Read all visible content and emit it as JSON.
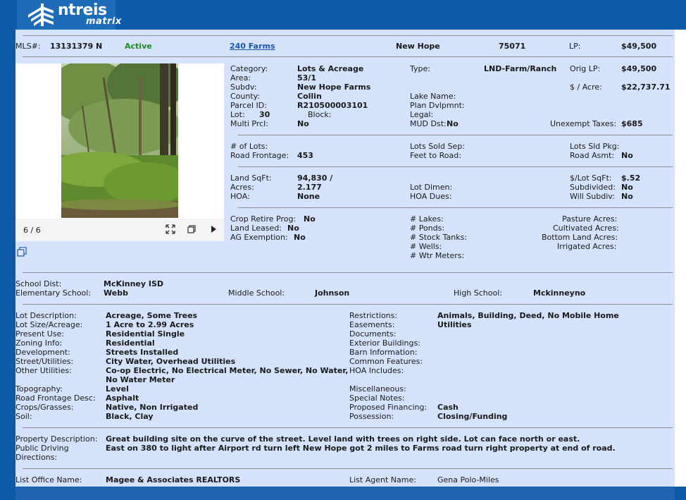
{
  "app": {
    "brand_main": "ntreis",
    "brand_sub": "matrix"
  },
  "summary": {
    "mls_label": "MLS#:",
    "mls_number": "13131379 N",
    "status": "Active",
    "address": "240 Farms",
    "city": "New Hope",
    "zip": "75071",
    "lp_label": "LP:",
    "lp_value": "$49,500"
  },
  "photo": {
    "counter": "6 / 6"
  },
  "fields": {
    "category_label": "Category:",
    "category_value": "Lots & Acreage",
    "area_label": "Area:",
    "area_value": "53/1",
    "subdv_label": "Subdv:",
    "subdv_value": "New Hope Farms",
    "county_label": "County:",
    "county_value": "Collin",
    "parcel_label": "Parcel ID:",
    "parcel_value": "R210500003101",
    "lot_label": "Lot:",
    "lot_value": "30",
    "block_label": "Block:",
    "multi_label": "Multi Prcl:",
    "multi_value": "No",
    "type_label": "Type:",
    "type_value": "LND-Farm/Ranch",
    "lake_label": "Lake Name:",
    "plan_label": "Plan Dvlpmnt:",
    "legal_label": "Legal:",
    "mud_label": "MUD Dst:",
    "mud_value": "No",
    "origlp_label": "Orig LP:",
    "origlp_value": "$49,500",
    "peracre_label": "$ / Acre:",
    "peracre_value": "$22,737.71",
    "taxes_label": "Unexempt Taxes:",
    "taxes_value": "$685",
    "numlots_label": "# of Lots:",
    "frontage_label": "Road Frontage:",
    "frontage_value": "453",
    "soldsep_label": "Lots Sold Sep:",
    "feet_label": "Feet to Road:",
    "sldpkg_label": "Lots Sld Pkg:",
    "roadasmt_label": "Road Asmt:",
    "roadasmt_value": "No",
    "sqft_label": "Land SqFt:",
    "sqft_value": "94,830 /",
    "acres_label": "Acres:",
    "acres_value": "2.177",
    "hoa_label": "HOA:",
    "hoa_value": "None",
    "lotdimen_label": "Lot Dimen:",
    "hoadues_label": "HOA Dues:",
    "lotsqft_label": "$/Lot SqFt:",
    "lotsqft_value": "$.52",
    "subdivided_label": "Subdivided:",
    "subdivided_value": "No",
    "willsub_label": "Will Subdiv:",
    "willsub_value": "No",
    "crop_label": "Crop Retire Prog:",
    "crop_value": "No",
    "leased_label": "Land Leased:",
    "leased_value": "No",
    "ag_label": "AG Exemption:",
    "ag_value": "No",
    "lakes_label": "# Lakes:",
    "ponds_label": "# Ponds:",
    "tanks_label": "# Stock Tanks:",
    "wells_label": "# Wells:",
    "meters_label": "# Wtr Meters:",
    "pasture_label": "Pasture Acres:",
    "cultivated_label": "Cultivated Acres:",
    "bottom_label": "Bottom Land Acres:",
    "irrigated_label": "Irrigated Acres:"
  },
  "school": {
    "dist_label": "School Dist:",
    "dist_value": "McKinney ISD",
    "elem_label": "Elementary School:",
    "elem_value": "Webb",
    "middle_label": "Middle School:",
    "middle_value": "Johnson",
    "high_label": "High School:",
    "high_value": "Mckinneyno"
  },
  "details": {
    "lotdesc_label": "Lot Description:",
    "lotdesc_value": "Acreage, Some Trees",
    "lotsize_label": "Lot Size/Acreage:",
    "lotsize_value": "1 Acre to 2.99 Acres",
    "use_label": "Present Use:",
    "use_value": "Residential Single",
    "zoning_label": "Zoning Info:",
    "zoning_value": "Residential",
    "dev_label": "Development:",
    "dev_value": "Streets Installed",
    "street_label": "Street/Utilities:",
    "street_value": "City Water, Overhead Utilities",
    "other_label": "Other Utilities:",
    "other_value_1": "Co-op Electric, No Electrical Meter, No Sewer, No Water,",
    "other_value_2": "No Water Meter",
    "topo_label": "Topography:",
    "topo_value": "Level",
    "roadfront_label": "Road Frontage Desc:",
    "roadfront_value": "Asphalt",
    "crops_label": "Crops/Grasses:",
    "crops_value": "Native, Non Irrigated",
    "soil_label": "Soil:",
    "soil_value": "Black, Clay",
    "restr_label": "Restrictions:",
    "restr_value": "Animals, Building, Deed, No Mobile Home",
    "ease_label": "Easements:",
    "ease_value": "Utilities",
    "docs_label": "Documents:",
    "extb_label": "Exterior Buildings:",
    "barn_label": "Barn Information:",
    "common_label": "Common Features:",
    "hoainc_label": "HOA Includes:",
    "misc_label": "Miscellaneous:",
    "special_label": "Special Notes:",
    "financing_label": "Proposed Financing:",
    "financing_value": "Cash",
    "possession_label": "Possession:",
    "possession_value": "Closing/Funding"
  },
  "remarks": {
    "desc_label": "Property Description:",
    "desc_value": "Great building site on the curve of the street. Level land with trees on right side. Lot can face north or east.",
    "dir_label_1": "Public Driving",
    "dir_label_2": "Directions:",
    "dir_value": "East on 380 to light after Airport rd turn left New Hope got 2 miles to Farms road turn right property at end of road."
  },
  "office": {
    "office_label": "List Office Name:",
    "office_value": "Magee & Associates REALTORS",
    "agent_label": "List Agent Name:",
    "agent_value": "Gena Polo-Miles"
  },
  "colors": {
    "header_blue": "#0e5aa7",
    "panel_bg": "#d5e2fb",
    "status_green": "#1c8a1c",
    "link_blue": "#1a55b0"
  },
  "icons": [
    "logo-icon",
    "expand-icon",
    "gallery-icon",
    "play-icon",
    "copy-icon"
  ]
}
